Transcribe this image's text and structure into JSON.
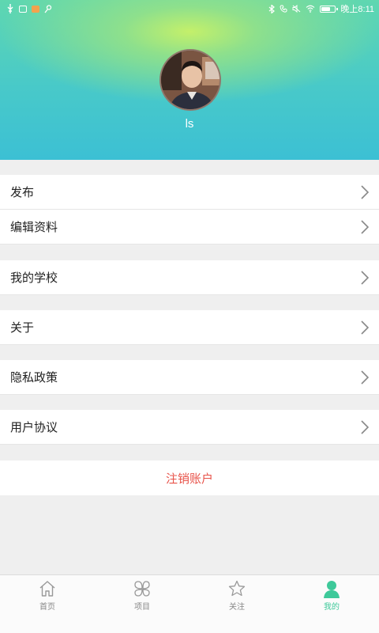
{
  "status_bar": {
    "time": "晚上8:11",
    "battery_level": 0.7,
    "left_icons": [
      "usb-icon",
      "image-icon",
      "play-store-icon",
      "key-icon"
    ],
    "right_icons": [
      "bluetooth-icon",
      "phone-icon",
      "mute-icon",
      "wifi-icon",
      "battery-icon"
    ]
  },
  "profile": {
    "username": "ls",
    "avatar": "avatar-photo"
  },
  "menu": {
    "items": [
      {
        "label": "发布"
      },
      {
        "label": "编辑资料"
      },
      {
        "label": "我的学校"
      },
      {
        "label": "关于"
      },
      {
        "label": "隐私政策"
      },
      {
        "label": "用户协议"
      }
    ],
    "logout_label": "注销账户"
  },
  "tabbar": {
    "tabs": [
      {
        "label": "首页",
        "icon": "home-icon"
      },
      {
        "label": "项目",
        "icon": "clover-icon"
      },
      {
        "label": "关注",
        "icon": "star-icon"
      },
      {
        "label": "我的",
        "icon": "person-icon"
      }
    ],
    "active_index": 3
  },
  "colors": {
    "accent": "#3ec99a",
    "logout": "#e8534a",
    "header_top": "#c4f06a",
    "header_bottom": "#3cc0d4"
  }
}
